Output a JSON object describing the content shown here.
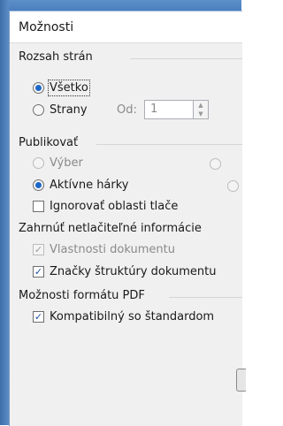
{
  "dialog": {
    "title": "Možnosti"
  },
  "range": {
    "heading": "Rozsah strán",
    "all_label": "Všetko",
    "pages_label": "Strany",
    "from_label": "Od:",
    "from_value": "1"
  },
  "publish": {
    "heading": "Publikovať",
    "selection_label": "Výber",
    "active_sheets_label": "Aktívne hárky",
    "ignore_print_areas_label": "Ignorovať oblasti tlače"
  },
  "nonprint": {
    "heading": "Zahrnúť netlačiteľné informácie",
    "doc_props_label": "Vlastnosti dokumentu",
    "struct_tags_label": "Značky štruktúry dokumentu"
  },
  "pdf": {
    "heading": "Možnosti formátu PDF",
    "compatible_label": "Kompatibilný so štandardom"
  }
}
